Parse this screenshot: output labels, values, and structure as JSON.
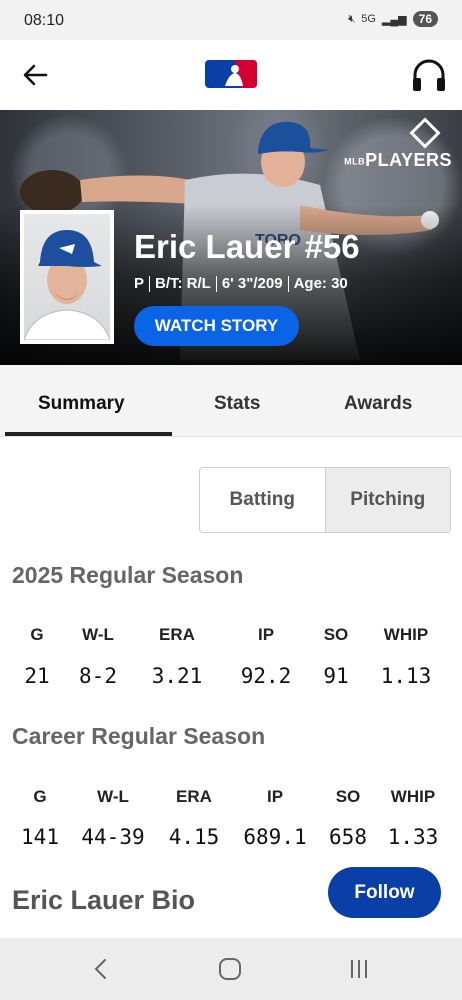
{
  "status": {
    "time": "08:10",
    "network": "5G",
    "battery": "76"
  },
  "header": {
    "back_icon": "arrow-left-icon",
    "logo_icon": "mlb-logo-icon",
    "audio_icon": "headphones-icon"
  },
  "hero": {
    "players_logo_text": "PLAYERS",
    "players_logo_prefix": "MLB",
    "player_name": "Eric Lauer #56",
    "position": "P",
    "bats_throws": "B/T: R/L",
    "height_weight": "6' 3\"/209",
    "age": "Age: 30",
    "watch_story_label": "WATCH STORY"
  },
  "tabs": [
    {
      "label": "Summary",
      "active": true
    },
    {
      "label": "Stats",
      "active": false
    },
    {
      "label": "Awards",
      "active": false
    }
  ],
  "segment": {
    "batting_label": "Batting",
    "pitching_label": "Pitching",
    "selected": "Pitching"
  },
  "season": {
    "title": "2025 Regular Season",
    "headers": [
      "G",
      "W-L",
      "ERA",
      "IP",
      "SO",
      "WHIP"
    ],
    "values": [
      "21",
      "8-2",
      "3.21",
      "92.2",
      "91",
      "1.13"
    ]
  },
  "career": {
    "title": "Career Regular Season",
    "headers": [
      "G",
      "W-L",
      "ERA",
      "IP",
      "SO",
      "WHIP"
    ],
    "values": [
      "141",
      "44-39",
      "4.15",
      "689.1",
      "658",
      "1.33"
    ]
  },
  "bio": {
    "title": "Eric Lauer Bio",
    "follow_label": "Follow"
  },
  "colors": {
    "accent_blue": "#0b63e6",
    "follow_blue": "#0b3fa8",
    "mlb_blue": "#0b3fa8",
    "mlb_red": "#d50032"
  }
}
